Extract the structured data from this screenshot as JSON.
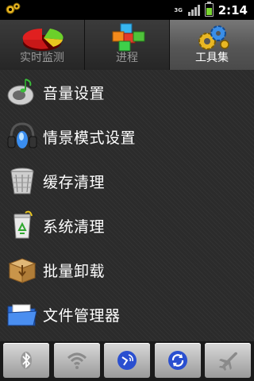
{
  "status_bar": {
    "network": "3G",
    "time": "2:14"
  },
  "tabs": [
    {
      "label": "实时监测",
      "active": false,
      "icon": "pie-chart-icon"
    },
    {
      "label": "进程",
      "active": false,
      "icon": "cubes-icon"
    },
    {
      "label": "工具集",
      "active": true,
      "icon": "gears-icon"
    }
  ],
  "menu": {
    "items": [
      {
        "label": "音量设置",
        "icon": "speaker-icon"
      },
      {
        "label": "情景模式设置",
        "icon": "headphones-icon"
      },
      {
        "label": "缓存清理",
        "icon": "trash-can-icon"
      },
      {
        "label": "系统清理",
        "icon": "recycle-bin-icon"
      },
      {
        "label": "批量卸载",
        "icon": "box-icon"
      },
      {
        "label": "文件管理器",
        "icon": "folder-icon"
      }
    ]
  },
  "toolbar": {
    "buttons": [
      {
        "icon": "bluetooth-icon"
      },
      {
        "icon": "wifi-icon"
      },
      {
        "icon": "gps-icon"
      },
      {
        "icon": "sync-icon"
      },
      {
        "icon": "airplane-icon"
      }
    ]
  }
}
